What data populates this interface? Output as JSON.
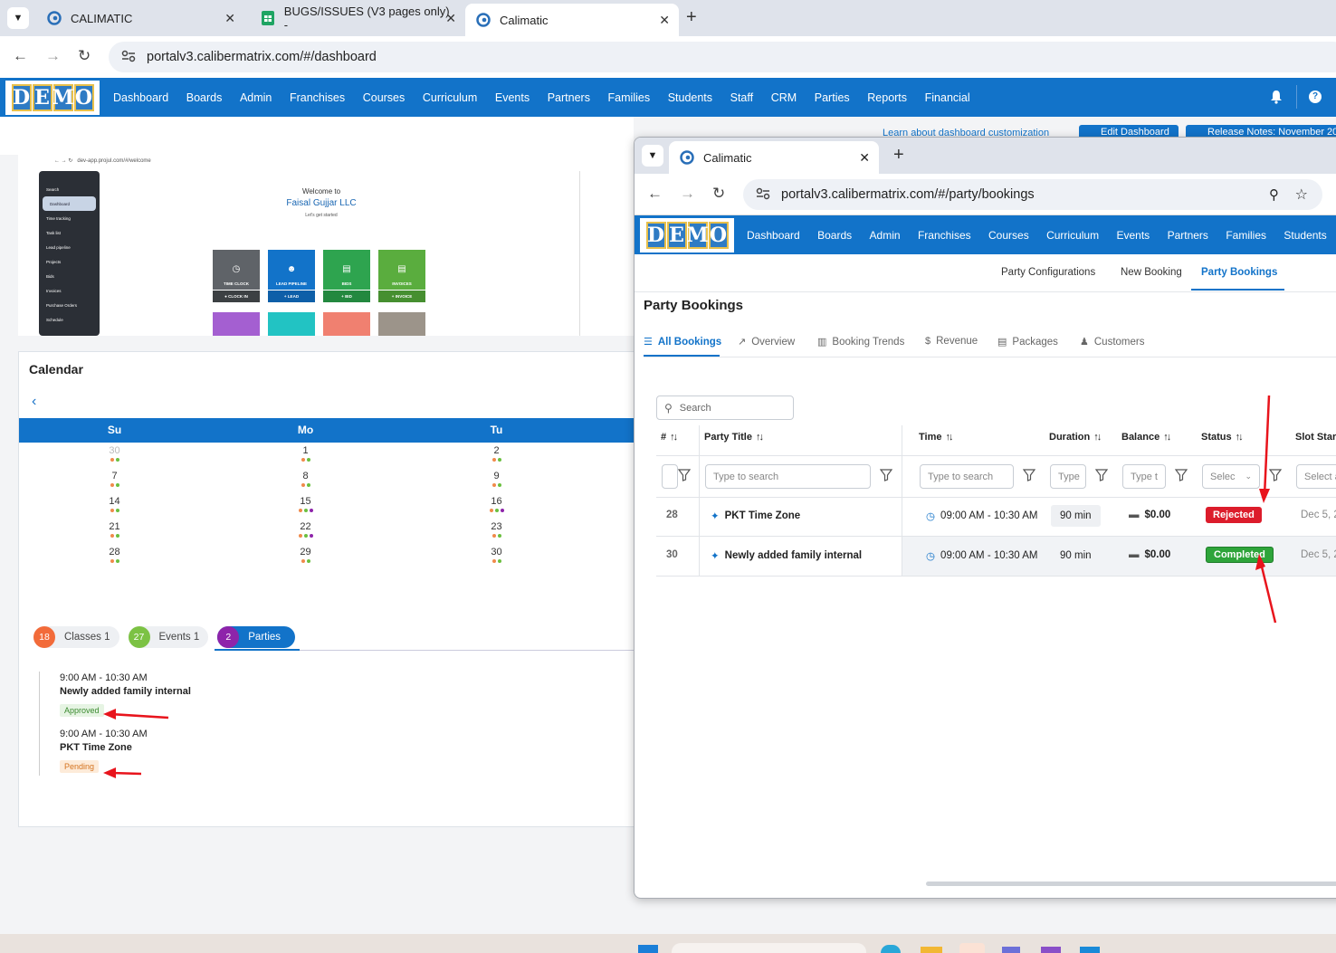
{
  "browser": {
    "tabs": [
      {
        "label": "CALIMATIC"
      },
      {
        "label": "BUGS/ISSUES (V3 pages only) -"
      },
      {
        "label": "Calimatic"
      }
    ],
    "url": "portalv3.calibermatrix.com/#/dashboard"
  },
  "app": {
    "logo_letters": [
      "D",
      "E",
      "M",
      "O"
    ],
    "menu": [
      "Dashboard",
      "Boards",
      "Admin",
      "Franchises",
      "Courses",
      "Curriculum",
      "Events",
      "Partners",
      "Families",
      "Students",
      "Staff",
      "CRM",
      "Parties",
      "Reports",
      "Financial"
    ]
  },
  "dashboard": {
    "toolbar": {
      "customize_link": "Learn about dashboard customization",
      "edit_button": "Edit Dashboard",
      "release_button": "Release Notes: November 20"
    },
    "welcome": {
      "mini_url": "dev-app.projul.com/#/welcome",
      "title": "Welcome to",
      "company": "Faisal Gujjar LLC",
      "subtitle": "Let's get started",
      "sidebar": [
        "Search",
        "Dashboard",
        "Time tracking",
        "Task list",
        "Lead pipeline",
        "Projects",
        "Bids",
        "Invoices",
        "Purchase Orders",
        "Schedule"
      ],
      "tiles": [
        {
          "label": "TIME CLOCK",
          "button": "CLOCK IN",
          "color": "#5f6368"
        },
        {
          "label": "LEAD PIPELINE",
          "button": "LEAD",
          "color": "#1273c9"
        },
        {
          "label": "BIDS",
          "button": "BID",
          "color": "#2ea44f"
        },
        {
          "label": "INVOICES",
          "button": "INVOICE",
          "color": "#5aad3e"
        }
      ],
      "tiles_row2_colors": [
        "#a45fd1",
        "#22c3c3",
        "#f08070",
        "#9c948a"
      ]
    },
    "calendar": {
      "title": "Calendar",
      "days": [
        "Su",
        "Mo",
        "Tu"
      ],
      "weeks": [
        [
          {
            "d": "30",
            "muted": true,
            "dots": [
              "#f08a4b",
              "#6bbf3f"
            ]
          },
          {
            "d": "1",
            "dots": [
              "#f08a4b",
              "#6bbf3f"
            ]
          },
          {
            "d": "2",
            "dots": [
              "#f08a4b",
              "#6bbf3f"
            ]
          }
        ],
        [
          {
            "d": "7",
            "dots": [
              "#f08a4b",
              "#6bbf3f"
            ]
          },
          {
            "d": "8",
            "dots": [
              "#f08a4b",
              "#6bbf3f"
            ]
          },
          {
            "d": "9",
            "dots": [
              "#f08a4b",
              "#6bbf3f"
            ]
          }
        ],
        [
          {
            "d": "14",
            "dots": [
              "#f08a4b",
              "#6bbf3f"
            ]
          },
          {
            "d": "15",
            "dots": [
              "#f08a4b",
              "#6bbf3f",
              "#8e24aa"
            ]
          },
          {
            "d": "16",
            "dots": [
              "#f08a4b",
              "#6bbf3f",
              "#8e24aa"
            ]
          }
        ],
        [
          {
            "d": "21",
            "dots": [
              "#f08a4b",
              "#6bbf3f"
            ]
          },
          {
            "d": "22",
            "dots": [
              "#f08a4b",
              "#6bbf3f",
              "#8e24aa"
            ]
          },
          {
            "d": "23",
            "dots": [
              "#f08a4b",
              "#6bbf3f"
            ]
          }
        ],
        [
          {
            "d": "28",
            "dots": [
              "#f08a4b",
              "#6bbf3f"
            ]
          },
          {
            "d": "29",
            "dots": [
              "#f08a4b",
              "#6bbf3f"
            ]
          },
          {
            "d": "30",
            "dots": [
              "#f08a4b",
              "#6bbf3f"
            ]
          }
        ]
      ],
      "legend": [
        {
          "count": "18",
          "label": "Classes 1",
          "color": "#f26b3a"
        },
        {
          "count": "27",
          "label": "Events 1",
          "color": "#7cc244"
        },
        {
          "count": "2",
          "label": "Parties",
          "color": "#8e24aa"
        }
      ],
      "events": [
        {
          "time": "9:00 AM - 10:30 AM",
          "name": "Newly added family internal",
          "status": "Approved"
        },
        {
          "time": "9:00 AM - 10:30 AM",
          "name": "PKT Time Zone",
          "status": "Pending"
        }
      ]
    }
  },
  "popup": {
    "tab_label": "Calimatic",
    "url": "portalv3.calibermatrix.com/#/party/bookings",
    "menu": [
      "Dashboard",
      "Boards",
      "Admin",
      "Franchises",
      "Courses",
      "Curriculum",
      "Events",
      "Partners",
      "Families",
      "Students"
    ],
    "subnav": [
      "Party Configurations",
      "New Booking",
      "Party Bookings"
    ],
    "page_title": "Party Bookings",
    "tabs": [
      "All Bookings",
      "Overview",
      "Booking Trends",
      "Revenue",
      "Packages",
      "Customers"
    ],
    "search_placeholder": "Search",
    "columns": [
      "#",
      "Party Title",
      "Time",
      "Duration",
      "Balance",
      "Status",
      "Slot Star"
    ],
    "filters": {
      "title": "Type to search",
      "time": "Type to search",
      "duration": "Type",
      "balance": "Type t",
      "status": "Selec",
      "slot": "Select a"
    },
    "rows": [
      {
        "id": "28",
        "title": "PKT Time Zone",
        "time": "09:00 AM - 10:30 AM",
        "duration": "90 min",
        "balance": "$0.00",
        "status": "Rejected",
        "status_color": "#dc1c2b",
        "slot": "Dec 5, 2"
      },
      {
        "id": "30",
        "title": "Newly added family internal",
        "time": "09:00 AM - 10:30 AM",
        "duration": "90 min",
        "balance": "$0.00",
        "status": "Completed",
        "status_color": "#2ea43a",
        "slot": "Dec 5, 2"
      }
    ]
  },
  "colors": {
    "brand": "#1273c9",
    "annotation_arrow": "#e8141c"
  }
}
